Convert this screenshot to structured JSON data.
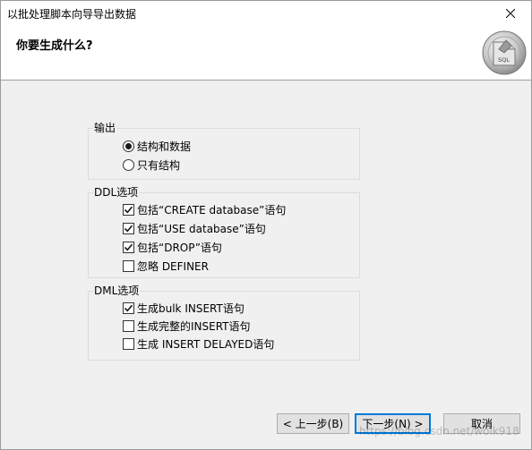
{
  "window": {
    "title": "以批处理脚本向导导出数据",
    "close_icon": "✕"
  },
  "header": {
    "question": "你要生成什么?",
    "logo_text": "SQL"
  },
  "output_group": {
    "label": "输出",
    "options": [
      {
        "label": "结构和数据",
        "checked": true
      },
      {
        "label": "只有结构",
        "checked": false
      }
    ]
  },
  "ddl_group": {
    "label": "DDL选项",
    "options": [
      {
        "label": "包括“CREATE database”语句",
        "checked": true
      },
      {
        "label": "包括“USE database”语句",
        "checked": true
      },
      {
        "label": "包括“DROP”语句",
        "checked": true
      },
      {
        "label": "忽略 DEFINER",
        "checked": false
      }
    ]
  },
  "dml_group": {
    "label": "DML选项",
    "options": [
      {
        "label": "生成bulk INSERT语句",
        "checked": true
      },
      {
        "label": "生成完整的INSERT语句",
        "checked": false
      },
      {
        "label": "生成 INSERT DELAYED语句",
        "checked": false
      }
    ]
  },
  "buttons": {
    "back": "< 上一步(B)",
    "next": "下一步(N) >",
    "cancel": "取消"
  },
  "watermark": "https://blog.csdn.net/wolk918"
}
